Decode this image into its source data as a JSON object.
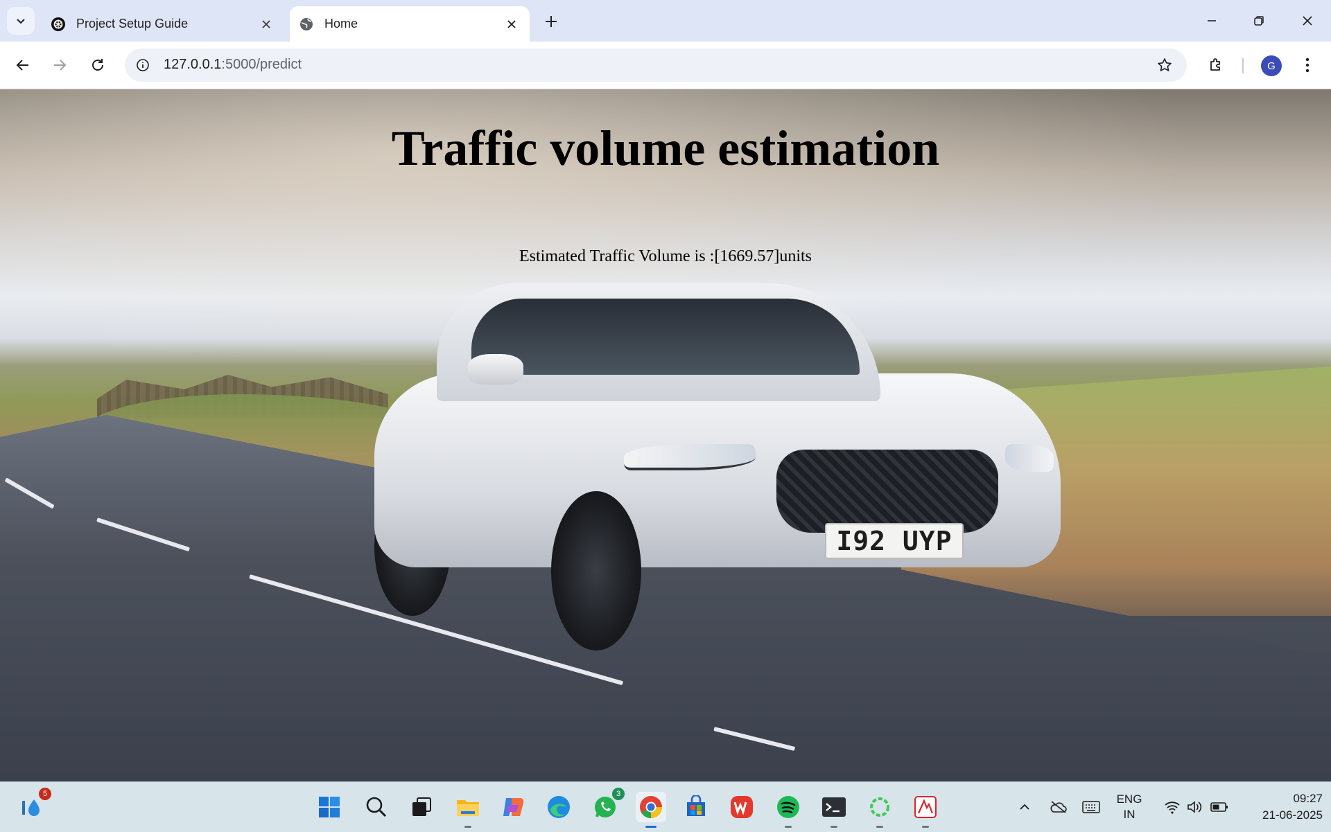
{
  "browser": {
    "tabs": [
      {
        "title": "Project Setup Guide",
        "icon": "openai-logo-icon",
        "active": false
      },
      {
        "title": "Home",
        "icon": "globe-icon",
        "active": true
      }
    ],
    "address": {
      "host": "127.0.0.1",
      "path": ":5000/predict"
    },
    "profile_initial": "G"
  },
  "page": {
    "heading": "Traffic volume estimation",
    "result_text": "Estimated Traffic Volume is :[1669.57]units",
    "background_image": {
      "subject": "white car driving on a rural road",
      "license_plate": "I92 UYP"
    }
  },
  "taskbar": {
    "pinned": [
      {
        "name": "widgets",
        "badge": "5"
      },
      {
        "name": "start"
      },
      {
        "name": "search"
      },
      {
        "name": "task-view"
      },
      {
        "name": "file-explorer",
        "running": true
      },
      {
        "name": "copilot"
      },
      {
        "name": "edge"
      },
      {
        "name": "whatsapp",
        "badge": "3"
      },
      {
        "name": "chrome",
        "running": true,
        "active": true
      },
      {
        "name": "microsoft-store"
      },
      {
        "name": "wps-office"
      },
      {
        "name": "spotify",
        "running": true
      },
      {
        "name": "terminal",
        "running": true
      },
      {
        "name": "green-ring-app",
        "running": true
      },
      {
        "name": "red-tool-app",
        "running": true
      }
    ],
    "language": {
      "line1": "ENG",
      "line2": "IN"
    },
    "time": "09:27",
    "date": "21-06-2025"
  },
  "colors": {
    "tabstrip": "#dde5f6",
    "toolbar": "#ffffff",
    "taskbar": "#d7e4ea",
    "profile": "#3b4cb8",
    "badge": "#c42b1c"
  }
}
